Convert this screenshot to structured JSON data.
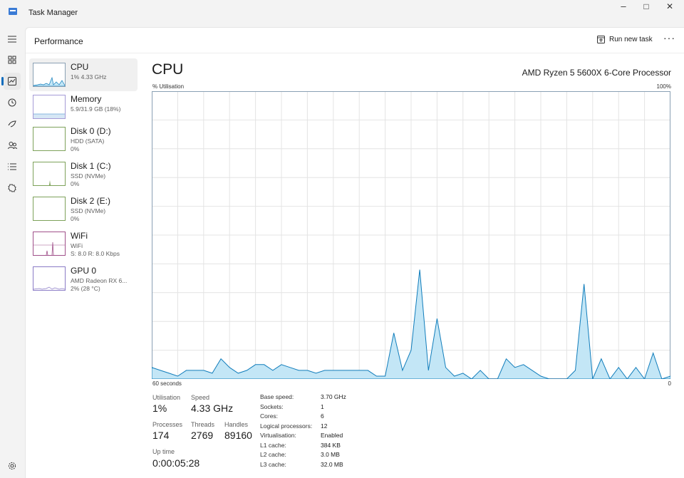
{
  "window": {
    "title": "Task Manager",
    "minimize": "–",
    "maximize": "□",
    "close": "✕"
  },
  "nav": {
    "items": [
      {
        "name": "hamburger-menu-icon"
      },
      {
        "name": "processes-icon"
      },
      {
        "name": "performance-icon"
      },
      {
        "name": "app-history-icon"
      },
      {
        "name": "startup-apps-icon"
      },
      {
        "name": "users-icon"
      },
      {
        "name": "details-icon"
      },
      {
        "name": "services-icon"
      },
      {
        "name": "settings-icon"
      }
    ]
  },
  "header": {
    "title": "Performance",
    "run_new_task": "Run new task",
    "more": "···"
  },
  "sidebar": {
    "items": [
      {
        "name": "CPU",
        "line1": "1% 4.33 GHz",
        "line2": ""
      },
      {
        "name": "Memory",
        "line1": "5.9/31.9 GB (18%)",
        "line2": ""
      },
      {
        "name": "Disk 0 (D:)",
        "line1": "HDD (SATA)",
        "line2": "0%"
      },
      {
        "name": "Disk 1 (C:)",
        "line1": "SSD (NVMe)",
        "line2": "0%"
      },
      {
        "name": "Disk 2 (E:)",
        "line1": "SSD (NVMe)",
        "line2": "0%"
      },
      {
        "name": "WiFi",
        "line1": "WiFi",
        "line2": "S: 8.0 R: 8.0 Kbps"
      },
      {
        "name": "GPU 0",
        "line1": "AMD Radeon RX 6...",
        "line2": "2% (28 °C)"
      }
    ]
  },
  "main": {
    "title": "CPU",
    "model": "AMD Ryzen 5 5600X 6-Core Processor",
    "y_label": "% Utilisation",
    "y_max_label": "100%",
    "x_left": "60 seconds",
    "x_right": "0"
  },
  "chart_data": {
    "type": "area",
    "ylabel": "% Utilisation",
    "ylim": [
      0,
      100
    ],
    "x": [
      60,
      59,
      58,
      57,
      56,
      55,
      54,
      53,
      52,
      51,
      50,
      49,
      48,
      47,
      46,
      45,
      44,
      43,
      42,
      41,
      40,
      39,
      38,
      37,
      36,
      35,
      34,
      33,
      32,
      31,
      30,
      29,
      28,
      27,
      26,
      25,
      24,
      23,
      22,
      21,
      20,
      19,
      18,
      17,
      16,
      15,
      14,
      13,
      12,
      11,
      10,
      9,
      8,
      7,
      6,
      5,
      4,
      3,
      2,
      1,
      0
    ],
    "values": [
      4,
      3,
      2,
      1,
      3,
      3,
      3,
      2,
      7,
      4,
      2,
      3,
      5,
      5,
      3,
      5,
      4,
      3,
      3,
      2,
      3,
      3,
      3,
      3,
      3,
      3,
      1,
      1,
      16,
      3,
      10,
      38,
      3,
      21,
      4,
      1,
      2,
      0,
      3,
      0,
      0,
      7,
      4,
      5,
      3,
      1,
      0,
      0,
      0,
      3,
      33,
      0,
      7,
      0,
      4,
      0,
      4,
      0,
      9,
      0,
      1
    ],
    "grid": true,
    "color": "#117dbb",
    "fill": "#c3e6f6"
  },
  "stats": {
    "utilisation": {
      "label": "Utilisation",
      "value": "1%"
    },
    "speed": {
      "label": "Speed",
      "value": "4.33 GHz"
    },
    "processes": {
      "label": "Processes",
      "value": "174"
    },
    "threads": {
      "label": "Threads",
      "value": "2769"
    },
    "handles": {
      "label": "Handles",
      "value": "89160"
    },
    "uptime": {
      "label": "Up time",
      "value": "0:00:05:28"
    }
  },
  "specs": [
    {
      "label": "Base speed:",
      "value": "3.70 GHz"
    },
    {
      "label": "Sockets:",
      "value": "1"
    },
    {
      "label": "Cores:",
      "value": "6"
    },
    {
      "label": "Logical processors:",
      "value": "12"
    },
    {
      "label": "Virtualisation:",
      "value": "Enabled"
    },
    {
      "label": "L1 cache:",
      "value": "384 KB"
    },
    {
      "label": "L2 cache:",
      "value": "3.0 MB"
    },
    {
      "label": "L3 cache:",
      "value": "32.0 MB"
    }
  ]
}
